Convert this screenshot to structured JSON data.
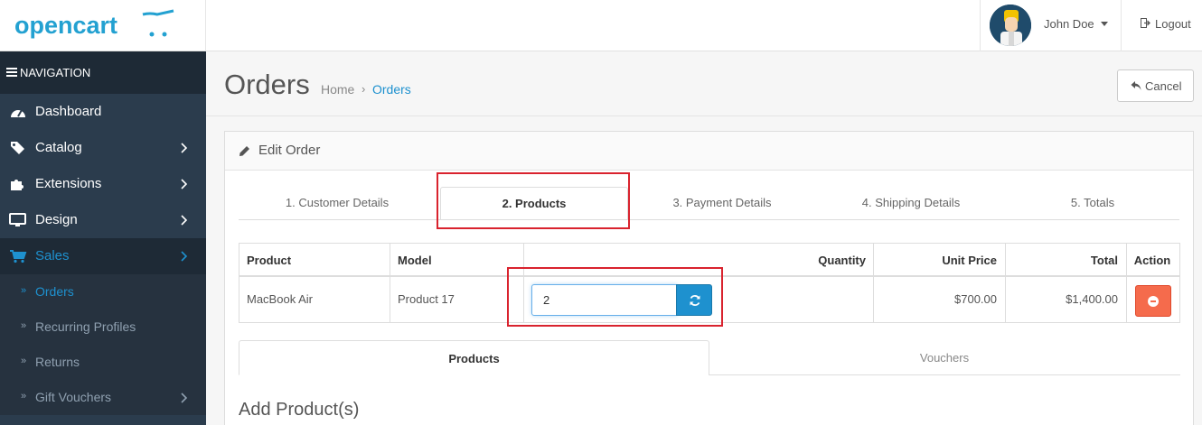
{
  "header": {
    "logo_text": "opencart",
    "user_name": "John Doe",
    "logout_label": "Logout"
  },
  "sidebar": {
    "heading": "NAVIGATION",
    "items": [
      {
        "label": "Dashboard",
        "icon": "dashboard-icon"
      },
      {
        "label": "Catalog",
        "icon": "tags-icon"
      },
      {
        "label": "Extensions",
        "icon": "puzzle-icon"
      },
      {
        "label": "Design",
        "icon": "monitor-icon"
      },
      {
        "label": "Sales",
        "icon": "cart-icon"
      }
    ],
    "sales_sub": [
      {
        "label": "Orders"
      },
      {
        "label": "Recurring Profiles"
      },
      {
        "label": "Returns"
      },
      {
        "label": "Gift Vouchers"
      }
    ]
  },
  "page": {
    "title": "Orders",
    "breadcrumb": [
      "Home",
      "Orders"
    ],
    "breadcrumb_sep": "›",
    "cancel_label": "Cancel"
  },
  "panel": {
    "title": "Edit Order",
    "steps": [
      "1. Customer Details",
      "2. Products",
      "3. Payment Details",
      "4. Shipping Details",
      "5. Totals"
    ],
    "active_step": "2. Products"
  },
  "table": {
    "headers": [
      "Product",
      "Model",
      "Quantity",
      "Unit Price",
      "Total",
      "Action"
    ],
    "rows": [
      {
        "product": "MacBook Air",
        "model": "Product 17",
        "quantity": "2",
        "unit_price": "$700.00",
        "total": "$1,400.00"
      }
    ]
  },
  "sub_tabs": [
    "Products",
    "Vouchers"
  ],
  "add_products_title": "Add Product(s)",
  "colors": {
    "accent": "#1e91cf",
    "sidebar": "#2b3c4d",
    "danger": "#f56b4c",
    "highlight": "#d9232e"
  }
}
